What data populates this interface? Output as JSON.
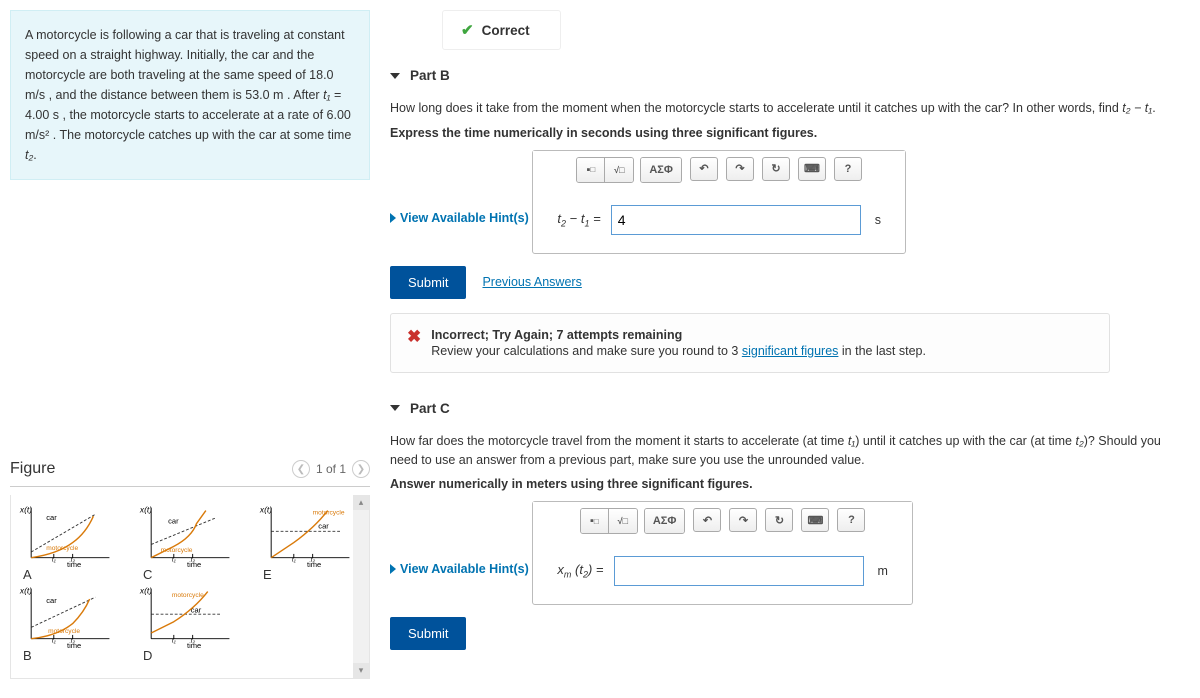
{
  "problem": {
    "text_parts": [
      "A motorcycle is following a car that is traveling at constant speed on a straight highway. Initially, the car and the motorcycle are both traveling at the same speed of 18.0 m/s , and the distance between them is 53.0 m . After ",
      " = 4.00 s , the motorcycle starts to accelerate at a rate of 6.00 m/s² . The motorcycle catches up with the car at some time ",
      "."
    ],
    "t1": "t₁",
    "t2": "t₂"
  },
  "figure": {
    "heading": "Figure",
    "nav": {
      "label": "1 of 1"
    },
    "labels": {
      "A": "A",
      "B": "B",
      "C": "C",
      "D": "D",
      "E": "E"
    },
    "axis": {
      "y": "x(t)",
      "x": "time",
      "t1": "t₁",
      "t2": "t₂",
      "car": "car",
      "motorcycle": "motorcycle"
    }
  },
  "correct": {
    "label": "Correct"
  },
  "partB": {
    "header": "Part B",
    "prompt_pre": "How long does it take from the moment when the motorcycle starts to accelerate until it catches up with the car? In other words, find ",
    "prompt_expr": "t₂ − t₁",
    "prompt_post": ".",
    "express": "Express the time numerically in seconds using three significant figures.",
    "hint": "View Available Hint(s)",
    "var_label_html": "t₂ − t₁ =",
    "value": "4",
    "unit": "s",
    "submit": "Submit",
    "prev": "Previous Answers",
    "feedback": {
      "title": "Incorrect; Try Again; 7 attempts remaining",
      "body_pre": "Review your calculations and make sure you round to 3 ",
      "body_link": "significant figures",
      "body_post": " in the last step."
    }
  },
  "partC": {
    "header": "Part C",
    "prompt_pre": "How far does the motorcycle travel from the moment it starts to accelerate (at time ",
    "pm1": "t₁",
    "prompt_mid": ") until it catches up with the car (at time ",
    "pm2": "t₂",
    "prompt_post": ")? Should you need to use an answer from a previous part, make sure you use the unrounded value.",
    "express": "Answer numerically in meters using three significant figures.",
    "hint": "View Available Hint(s)",
    "var_label": "xₘ (t₂) =",
    "value": "",
    "unit": "m",
    "submit": "Submit"
  },
  "toolbar": {
    "greek": "ΑΣΦ"
  }
}
